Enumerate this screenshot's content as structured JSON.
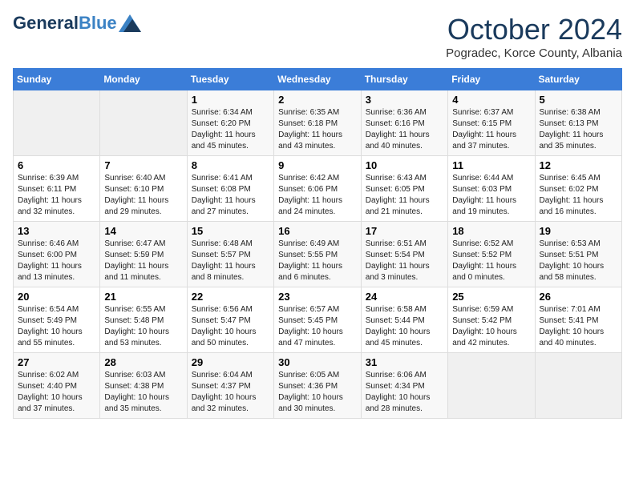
{
  "header": {
    "logo": {
      "general": "General",
      "blue": "Blue"
    },
    "title": "October 2024",
    "location": "Pogradec, Korce County, Albania"
  },
  "calendar": {
    "days_of_week": [
      "Sunday",
      "Monday",
      "Tuesday",
      "Wednesday",
      "Thursday",
      "Friday",
      "Saturday"
    ],
    "weeks": [
      [
        {
          "day": "",
          "sunrise": "",
          "sunset": "",
          "daylight": ""
        },
        {
          "day": "",
          "sunrise": "",
          "sunset": "",
          "daylight": ""
        },
        {
          "day": "1",
          "sunrise": "Sunrise: 6:34 AM",
          "sunset": "Sunset: 6:20 PM",
          "daylight": "Daylight: 11 hours and 45 minutes."
        },
        {
          "day": "2",
          "sunrise": "Sunrise: 6:35 AM",
          "sunset": "Sunset: 6:18 PM",
          "daylight": "Daylight: 11 hours and 43 minutes."
        },
        {
          "day": "3",
          "sunrise": "Sunrise: 6:36 AM",
          "sunset": "Sunset: 6:16 PM",
          "daylight": "Daylight: 11 hours and 40 minutes."
        },
        {
          "day": "4",
          "sunrise": "Sunrise: 6:37 AM",
          "sunset": "Sunset: 6:15 PM",
          "daylight": "Daylight: 11 hours and 37 minutes."
        },
        {
          "day": "5",
          "sunrise": "Sunrise: 6:38 AM",
          "sunset": "Sunset: 6:13 PM",
          "daylight": "Daylight: 11 hours and 35 minutes."
        }
      ],
      [
        {
          "day": "6",
          "sunrise": "Sunrise: 6:39 AM",
          "sunset": "Sunset: 6:11 PM",
          "daylight": "Daylight: 11 hours and 32 minutes."
        },
        {
          "day": "7",
          "sunrise": "Sunrise: 6:40 AM",
          "sunset": "Sunset: 6:10 PM",
          "daylight": "Daylight: 11 hours and 29 minutes."
        },
        {
          "day": "8",
          "sunrise": "Sunrise: 6:41 AM",
          "sunset": "Sunset: 6:08 PM",
          "daylight": "Daylight: 11 hours and 27 minutes."
        },
        {
          "day": "9",
          "sunrise": "Sunrise: 6:42 AM",
          "sunset": "Sunset: 6:06 PM",
          "daylight": "Daylight: 11 hours and 24 minutes."
        },
        {
          "day": "10",
          "sunrise": "Sunrise: 6:43 AM",
          "sunset": "Sunset: 6:05 PM",
          "daylight": "Daylight: 11 hours and 21 minutes."
        },
        {
          "day": "11",
          "sunrise": "Sunrise: 6:44 AM",
          "sunset": "Sunset: 6:03 PM",
          "daylight": "Daylight: 11 hours and 19 minutes."
        },
        {
          "day": "12",
          "sunrise": "Sunrise: 6:45 AM",
          "sunset": "Sunset: 6:02 PM",
          "daylight": "Daylight: 11 hours and 16 minutes."
        }
      ],
      [
        {
          "day": "13",
          "sunrise": "Sunrise: 6:46 AM",
          "sunset": "Sunset: 6:00 PM",
          "daylight": "Daylight: 11 hours and 13 minutes."
        },
        {
          "day": "14",
          "sunrise": "Sunrise: 6:47 AM",
          "sunset": "Sunset: 5:59 PM",
          "daylight": "Daylight: 11 hours and 11 minutes."
        },
        {
          "day": "15",
          "sunrise": "Sunrise: 6:48 AM",
          "sunset": "Sunset: 5:57 PM",
          "daylight": "Daylight: 11 hours and 8 minutes."
        },
        {
          "day": "16",
          "sunrise": "Sunrise: 6:49 AM",
          "sunset": "Sunset: 5:55 PM",
          "daylight": "Daylight: 11 hours and 6 minutes."
        },
        {
          "day": "17",
          "sunrise": "Sunrise: 6:51 AM",
          "sunset": "Sunset: 5:54 PM",
          "daylight": "Daylight: 11 hours and 3 minutes."
        },
        {
          "day": "18",
          "sunrise": "Sunrise: 6:52 AM",
          "sunset": "Sunset: 5:52 PM",
          "daylight": "Daylight: 11 hours and 0 minutes."
        },
        {
          "day": "19",
          "sunrise": "Sunrise: 6:53 AM",
          "sunset": "Sunset: 5:51 PM",
          "daylight": "Daylight: 10 hours and 58 minutes."
        }
      ],
      [
        {
          "day": "20",
          "sunrise": "Sunrise: 6:54 AM",
          "sunset": "Sunset: 5:49 PM",
          "daylight": "Daylight: 10 hours and 55 minutes."
        },
        {
          "day": "21",
          "sunrise": "Sunrise: 6:55 AM",
          "sunset": "Sunset: 5:48 PM",
          "daylight": "Daylight: 10 hours and 53 minutes."
        },
        {
          "day": "22",
          "sunrise": "Sunrise: 6:56 AM",
          "sunset": "Sunset: 5:47 PM",
          "daylight": "Daylight: 10 hours and 50 minutes."
        },
        {
          "day": "23",
          "sunrise": "Sunrise: 6:57 AM",
          "sunset": "Sunset: 5:45 PM",
          "daylight": "Daylight: 10 hours and 47 minutes."
        },
        {
          "day": "24",
          "sunrise": "Sunrise: 6:58 AM",
          "sunset": "Sunset: 5:44 PM",
          "daylight": "Daylight: 10 hours and 45 minutes."
        },
        {
          "day": "25",
          "sunrise": "Sunrise: 6:59 AM",
          "sunset": "Sunset: 5:42 PM",
          "daylight": "Daylight: 10 hours and 42 minutes."
        },
        {
          "day": "26",
          "sunrise": "Sunrise: 7:01 AM",
          "sunset": "Sunset: 5:41 PM",
          "daylight": "Daylight: 10 hours and 40 minutes."
        }
      ],
      [
        {
          "day": "27",
          "sunrise": "Sunrise: 6:02 AM",
          "sunset": "Sunset: 4:40 PM",
          "daylight": "Daylight: 10 hours and 37 minutes."
        },
        {
          "day": "28",
          "sunrise": "Sunrise: 6:03 AM",
          "sunset": "Sunset: 4:38 PM",
          "daylight": "Daylight: 10 hours and 35 minutes."
        },
        {
          "day": "29",
          "sunrise": "Sunrise: 6:04 AM",
          "sunset": "Sunset: 4:37 PM",
          "daylight": "Daylight: 10 hours and 32 minutes."
        },
        {
          "day": "30",
          "sunrise": "Sunrise: 6:05 AM",
          "sunset": "Sunset: 4:36 PM",
          "daylight": "Daylight: 10 hours and 30 minutes."
        },
        {
          "day": "31",
          "sunrise": "Sunrise: 6:06 AM",
          "sunset": "Sunset: 4:34 PM",
          "daylight": "Daylight: 10 hours and 28 minutes."
        },
        {
          "day": "",
          "sunrise": "",
          "sunset": "",
          "daylight": ""
        },
        {
          "day": "",
          "sunrise": "",
          "sunset": "",
          "daylight": ""
        }
      ]
    ]
  }
}
